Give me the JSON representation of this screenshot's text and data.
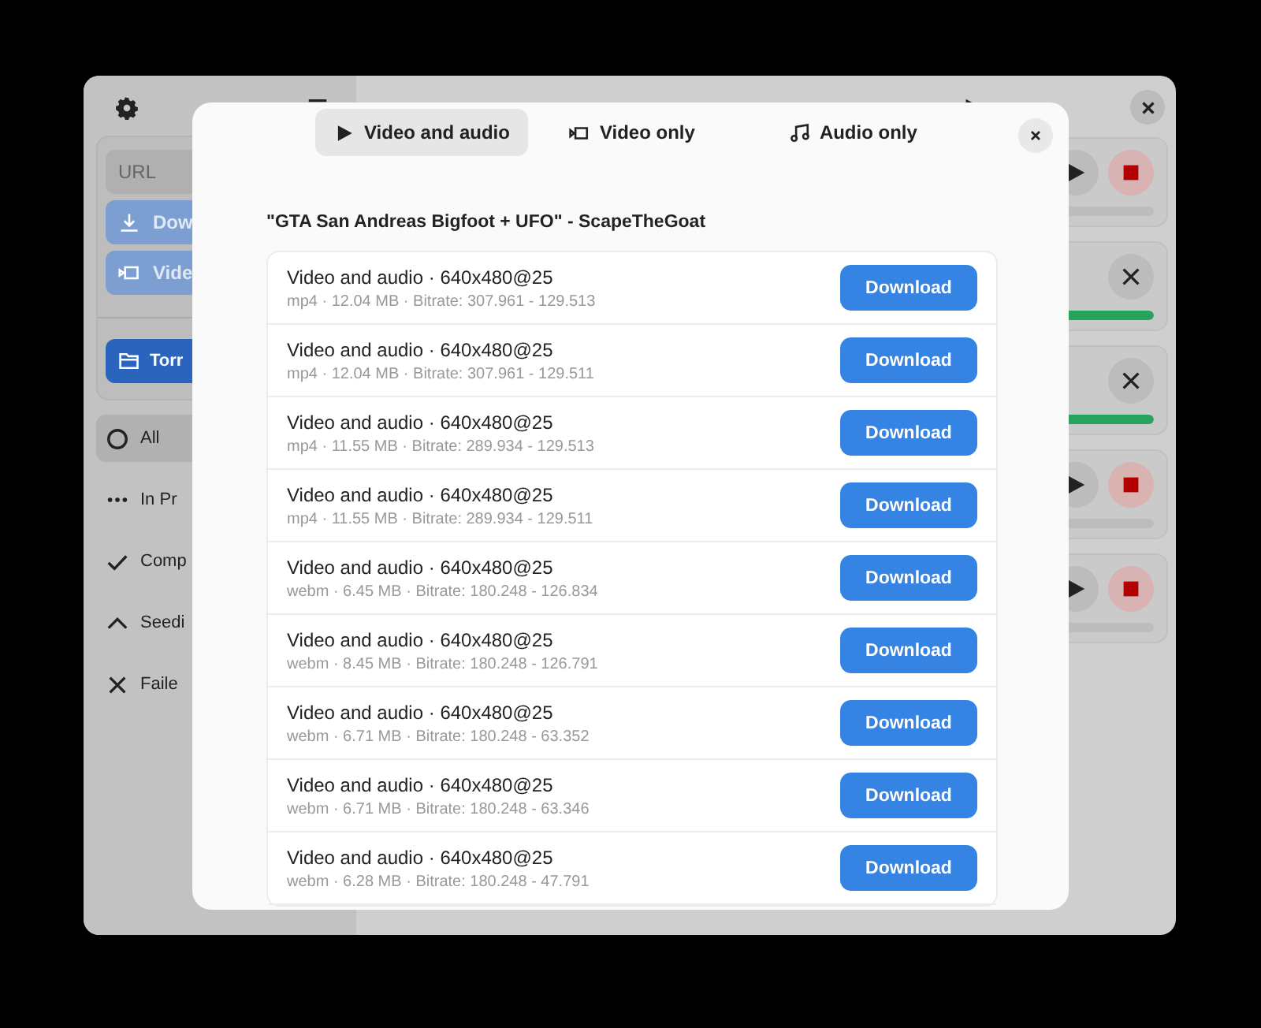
{
  "sidebar": {
    "url_field": {
      "placeholder": "URL"
    },
    "actions": [
      {
        "kind": "download",
        "label": "Dow",
        "disabled": true
      },
      {
        "kind": "video",
        "label": "Vide",
        "disabled": true
      },
      {
        "kind": "torrent",
        "label": "Torr",
        "disabled": false
      }
    ],
    "filters": [
      {
        "kind": "all",
        "label": "All",
        "selected": true
      },
      {
        "kind": "progress",
        "label": "In Pr",
        "selected": false
      },
      {
        "kind": "completed",
        "label": "Comp",
        "selected": false
      },
      {
        "kind": "seeding",
        "label": "Seedi",
        "selected": false
      },
      {
        "kind": "failed",
        "label": "Faile",
        "selected": false
      }
    ]
  },
  "downloads": [
    {
      "kind": "active",
      "level": 0
    },
    {
      "kind": "done",
      "level": 1
    },
    {
      "kind": "done",
      "level": 1
    },
    {
      "kind": "active",
      "level": 0
    },
    {
      "kind": "active",
      "level": 0
    }
  ],
  "dialog": {
    "tabs": [
      {
        "kind": "both",
        "label": "Video and audio",
        "selected": true
      },
      {
        "kind": "video",
        "label": "Video only",
        "selected": false
      },
      {
        "kind": "audio",
        "label": "Audio only",
        "selected": false
      }
    ],
    "title": "\"GTA San Andreas Bigfoot + UFO\" - ScapeTheGoat",
    "formats": [
      {
        "title": "Video and audio · 640x480@25",
        "details": "mp4 · 12.04 MB · Bitrate: 307.961 - 129.513",
        "button": "Download"
      },
      {
        "title": "Video and audio · 640x480@25",
        "details": "mp4 · 12.04 MB · Bitrate: 307.961 - 129.511",
        "button": "Download"
      },
      {
        "title": "Video and audio · 640x480@25",
        "details": "mp4 · 11.55 MB · Bitrate: 289.934 - 129.513",
        "button": "Download"
      },
      {
        "title": "Video and audio · 640x480@25",
        "details": "mp4 · 11.55 MB · Bitrate: 289.934 - 129.511",
        "button": "Download"
      },
      {
        "title": "Video and audio · 640x480@25",
        "details": "webm · 6.45 MB · Bitrate: 180.248 - 126.834",
        "button": "Download"
      },
      {
        "title": "Video and audio · 640x480@25",
        "details": "webm · 8.45 MB · Bitrate: 180.248 - 126.791",
        "button": "Download"
      },
      {
        "title": "Video and audio · 640x480@25",
        "details": "webm · 6.71 MB · Bitrate: 180.248 - 63.352",
        "button": "Download"
      },
      {
        "title": "Video and audio · 640x480@25",
        "details": "webm · 6.71 MB · Bitrate: 180.248 - 63.346",
        "button": "Download"
      },
      {
        "title": "Video and audio · 640x480@25",
        "details": "webm · 6.28 MB · Bitrate: 180.248 - 47.791",
        "button": "Download"
      }
    ]
  }
}
